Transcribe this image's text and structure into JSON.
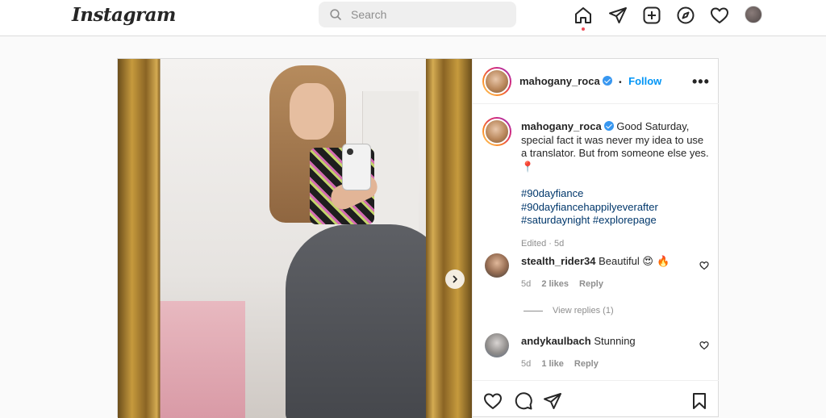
{
  "header": {
    "logo": "Instagram",
    "search_placeholder": "Search",
    "nav_icons": [
      "home-icon",
      "direct-icon",
      "new-post-icon",
      "explore-icon",
      "activity-heart-icon",
      "profile-avatar"
    ]
  },
  "post": {
    "author": "mahogany_roca",
    "follow_separator": "•",
    "follow_label": "Follow",
    "more_label": "•••",
    "caption": {
      "username": "mahogany_roca",
      "text": "Good Saturday, special fact it was never my idea to use a translator. But from someone else yes.",
      "emoji": "📍",
      "hashtags": [
        "#90dayfiance",
        "#90dayfiancehappilyeverafter",
        "#saturdaynight",
        "#explorepage"
      ],
      "edited": "Edited · 5d"
    },
    "comments": [
      {
        "username": "stealth_rider34",
        "text": "Beautiful",
        "emojis": "😍 🔥",
        "age": "5d",
        "likes": "2 likes",
        "reply": "Reply",
        "view_replies": "View replies (1)"
      },
      {
        "username": "andykaulbach",
        "text": "Stunning",
        "age": "5d",
        "likes": "1 like",
        "reply": "Reply"
      }
    ],
    "actions": [
      "like-icon",
      "comment-icon",
      "share-icon",
      "save-icon"
    ]
  },
  "colors": {
    "link_blue": "#0095f6",
    "hashtag": "#00376b",
    "muted": "#8e8e8e",
    "verified": "#3897f0"
  }
}
